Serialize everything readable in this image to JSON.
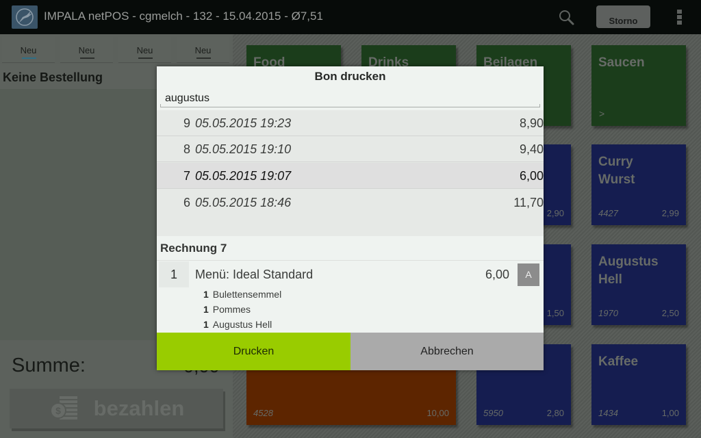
{
  "actionbar": {
    "title": "IMPALA netPOS - cgmelch - 132 - 15.04.2015 - Ø7,51",
    "logo_icon": "impala-logo-icon",
    "search_icon": "search-icon",
    "storno_label": "Storno",
    "overflow_icon": "overflow-menu-icon"
  },
  "left_panel": {
    "tabs": [
      {
        "label": "Neu",
        "active": true
      },
      {
        "label": "Neu",
        "active": false
      },
      {
        "label": "Neu",
        "active": false
      },
      {
        "label": "Neu",
        "active": false
      }
    ],
    "order_header": "Keine Bestellung",
    "summe_label": "Summe:",
    "summe_value": "0,00",
    "pay_label": "bezahlen",
    "pay_icon": "coins-icon"
  },
  "tiles": [
    {
      "name": "Food",
      "color": "#1b3d1b",
      "type": "category"
    },
    {
      "name": "Drinks",
      "color": "#1b3d1b",
      "type": "category"
    },
    {
      "name": "Beilagen",
      "color": "#1b3d1b",
      "type": "category"
    },
    {
      "name": "Saucen",
      "color": "#1b3d1b",
      "type": "category",
      "arrow": ">"
    },
    {
      "name": "",
      "color": "#151d50",
      "price": "2,90"
    },
    {
      "name": "Curry\nWurst",
      "color": "#151d50",
      "code": "4427",
      "price": "2,99"
    },
    {
      "name": "",
      "color": "#151d50",
      "price": "1,50"
    },
    {
      "name": "Augustus\nHell",
      "color": "#151d50",
      "code": "1970",
      "price": "2,50"
    },
    {
      "name": "",
      "color": "#5d2500",
      "code": "4528",
      "price": "10,00"
    },
    {
      "name": "",
      "color": "#151d50",
      "code": "5950",
      "price": "2,80"
    },
    {
      "name": "Kaffee",
      "color": "#151d50",
      "code": "1434",
      "price": "1,00"
    }
  ],
  "dialog": {
    "title": "Bon drucken",
    "search_value": "augustus",
    "bons": [
      {
        "num": "9",
        "date": "05.05.2015 19:23",
        "amount": "8,90",
        "selected": false
      },
      {
        "num": "8",
        "date": "05.05.2015 19:10",
        "amount": "9,40",
        "selected": false
      },
      {
        "num": "7",
        "date": "05.05.2015 19:07",
        "amount": "6,00",
        "selected": true
      },
      {
        "num": "6",
        "date": "05.05.2015 18:46",
        "amount": "11,70",
        "selected": false
      }
    ],
    "rechnung_title": "Rechnung 7",
    "item": {
      "qty": "1",
      "name": "Menü: Ideal Standard",
      "price": "6,00",
      "badge": "A",
      "sub_items": [
        {
          "qty": "1",
          "name": "Bulettensemmel"
        },
        {
          "qty": "1",
          "name": "Pommes"
        },
        {
          "qty": "1",
          "name": "Augustus Hell"
        }
      ]
    },
    "print_label": "Drucken",
    "cancel_label": "Abbrechen",
    "print_color": "#99cc00",
    "cancel_color": "#aaaaaa"
  }
}
